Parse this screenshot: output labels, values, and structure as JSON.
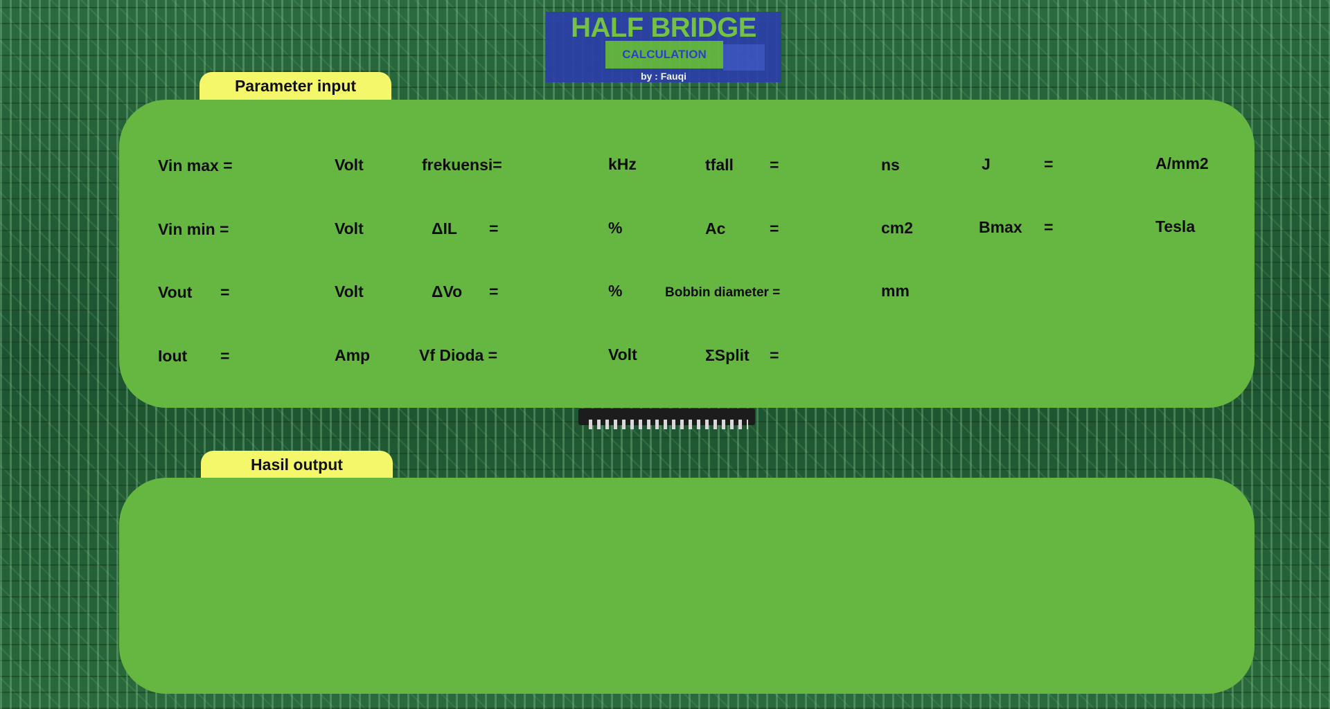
{
  "header": {
    "title": "HALF BRIDGE",
    "tab_label": "CALCULATION",
    "credit": "by : Fauqi"
  },
  "input_panel": {
    "tab_label": "Parameter input",
    "params": {
      "vin_max": {
        "label": "Vin max =",
        "unit": "Volt"
      },
      "vin_min": {
        "label": "Vin min =",
        "unit": "Volt"
      },
      "vout": {
        "label": "Vout",
        "eq": "=",
        "unit": "Volt"
      },
      "iout": {
        "label": "Iout",
        "eq": "=",
        "unit": "Amp"
      },
      "frekuensi": {
        "label": "frekuensi=",
        "unit": "kHz"
      },
      "delta_il": {
        "label": "ΔIL",
        "eq": "=",
        "unit": "%"
      },
      "delta_vo": {
        "label": "ΔVo",
        "eq": "=",
        "unit": "%"
      },
      "vf_dioda": {
        "label": "Vf Dioda =",
        "unit": "Volt"
      },
      "tfall": {
        "label": "tfall",
        "eq": "=",
        "unit": "ns"
      },
      "ac": {
        "label": "Ac",
        "eq": "=",
        "unit": "cm2"
      },
      "bobbin_diameter": {
        "label": "Bobbin diameter =",
        "unit": "mm"
      },
      "split": {
        "label": "ΣSplit",
        "eq": "="
      },
      "j": {
        "label": "J",
        "eq": "=",
        "unit": "A/mm2"
      },
      "bmax": {
        "label": "Bmax",
        "eq": "=",
        "unit": "Tesla"
      }
    }
  },
  "output_panel": {
    "tab_label": "Hasil output"
  },
  "colors": {
    "panel_green": "#65b741",
    "tab_yellow": "#f5f76a",
    "header_blue": "#2c3fa8",
    "title_green": "#7ac943",
    "background_pcb": "#1f5a34"
  }
}
